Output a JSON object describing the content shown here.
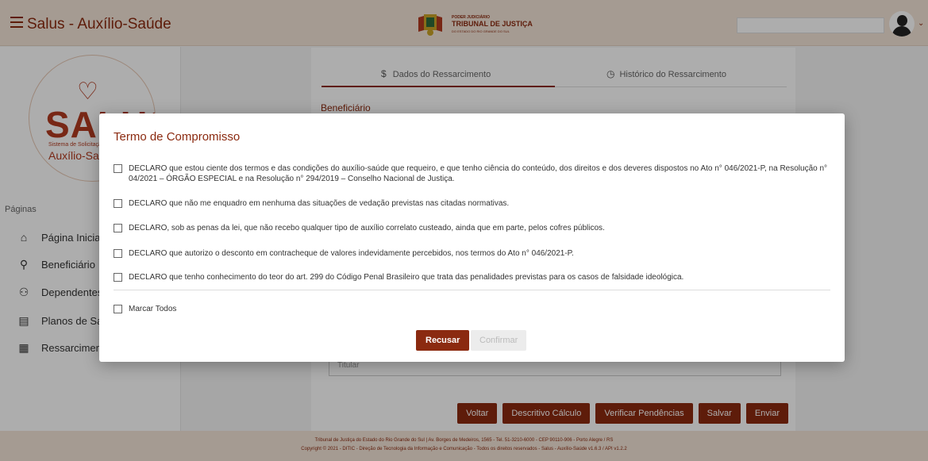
{
  "header": {
    "title": "Salus - Auxílio-Saúde",
    "org_top": "PODER JUDICIÁRIO",
    "org_name": "TRIBUNAL DE JUSTIÇA",
    "org_sub": "DO ESTADO DO RIO GRANDE DO SUL"
  },
  "logo": {
    "name": "SALUS",
    "subtitle": "Sistema de Solicitação do",
    "product": "Auxílio-Saúde"
  },
  "sidebar": {
    "title": "Páginas",
    "items": [
      {
        "label": "Página Inicial",
        "icon": "home-icon"
      },
      {
        "label": "Beneficiário",
        "icon": "user-icon"
      },
      {
        "label": "Dependentes",
        "icon": "users-icon"
      },
      {
        "label": "Planos de Saúde",
        "icon": "plan-icon"
      },
      {
        "label": "Ressarcimentos",
        "icon": "receipt-icon"
      }
    ]
  },
  "main": {
    "tabs": [
      {
        "label": "Dados do Ressarcimento",
        "icon_glyph": "$"
      },
      {
        "label": "Histórico do Ressarcimento",
        "icon_glyph": "◷"
      }
    ],
    "section_label": "Beneficiário",
    "titular_placeholder": "Titular",
    "buttons": [
      "Voltar",
      "Descritivo Cálculo",
      "Verificar Pendências",
      "Salvar",
      "Enviar"
    ]
  },
  "modal": {
    "title": "Termo de Compromisso",
    "declarations": [
      "DECLARO que estou ciente dos termos e das condições do auxílio-saúde que requeiro, e que tenho ciência do conteúdo, dos direitos e dos deveres dispostos no Ato n° 046/2021-P, na Resolução n° 04/2021 – ÓRGÃO ESPECIAL e na Resolução n° 294/2019 – Conselho Nacional de Justiça.",
      "DECLARO que não me enquadro em nenhuma das situações de vedação previstas nas citadas normativas.",
      "DECLARO, sob as penas da lei, que não recebo qualquer tipo de auxílio correlato custeado, ainda que em parte, pelos cofres públicos.",
      "DECLARO que autorizo o desconto em contracheque de valores indevidamente percebidos, nos termos do Ato n° 046/2021-P.",
      "DECLARO que tenho conhecimento do teor do art. 299 do Código Penal Brasileiro que trata das penalidades previstas para os casos de falsidade ideológica."
    ],
    "select_all": "Marcar Todos",
    "btn_refuse": "Recusar",
    "btn_confirm": "Confirmar"
  },
  "footer": {
    "line1": "Tribunal de Justiça do Estado do Rio Grande do Sul | Av. Borges de Medeiros, 1565 - Tel. 51-3210-6000 - CEP 90110-906 - Porto Alegre / RS",
    "line2": "Copyright © 2021 - DITIC - Direção de Tecnologia da Informação e Comunicação - Todos os direitos reservados - Salus - Auxílio-Saúde v1.6.3 / API v1.2.2"
  },
  "colors": {
    "brand": "#8b2a10",
    "header_bg": "#f3e5d8"
  }
}
